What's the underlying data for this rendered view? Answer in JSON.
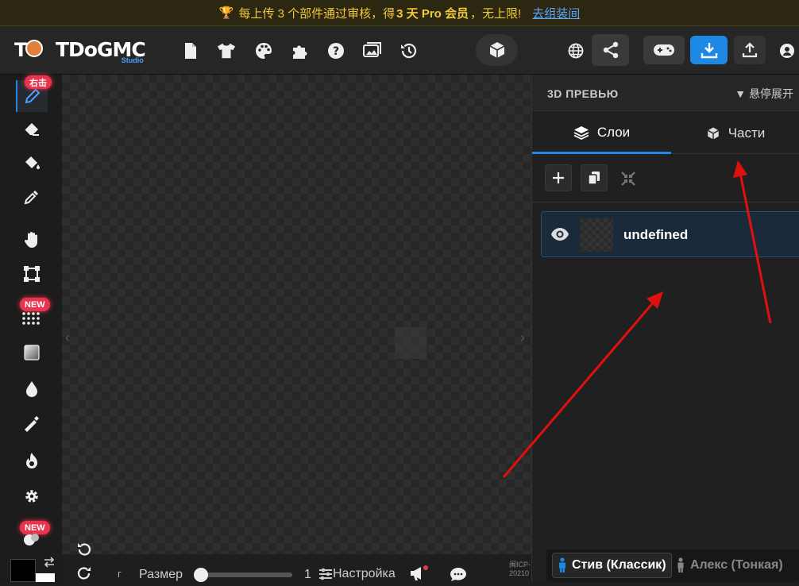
{
  "banner": {
    "prefix": "每上传 3 个部件通过审核，得",
    "highlight": "3 天 Pro 会员",
    "suffix": "，无上限!",
    "link": "去组装间"
  },
  "app": {
    "logo_t": "T",
    "name": "TDoGMC",
    "studio": "Studio"
  },
  "toolbar": {
    "icons": [
      "file-icon",
      "shirt-icon",
      "palette-icon",
      "puzzle-icon",
      "help-icon",
      "gallery-icon",
      "history-icon"
    ],
    "view_3d": "cube-icon",
    "right_icons": [
      "globe-icon",
      "share-icon",
      "gamepad-icon",
      "download-icon",
      "upload-icon",
      "account-icon"
    ],
    "accent": "#1e88e5"
  },
  "sidebar": {
    "badges": {
      "pencil": "右击",
      "grid": "NEW",
      "filter": "NEW"
    },
    "tools": [
      "pencil-icon",
      "eraser-icon",
      "bucket-icon",
      "eyedropper-icon",
      "hand-icon",
      "transform-icon",
      "dots-grid-icon",
      "gradient-icon",
      "blur-drop-icon",
      "brush-icon",
      "burn-icon",
      "settings-gear-icon",
      "filter-icon"
    ]
  },
  "bottom": {
    "size_prefix": "г",
    "size_label": "Размер",
    "size_value": "1",
    "size_fraction": 0,
    "settings_label": "Настройка",
    "icp_line1": "闽ICP-",
    "icp_line2": "20210"
  },
  "panel": {
    "title": "3D ПРЕВЬЮ",
    "hover_label": "▼ 悬停展开",
    "tabs": [
      {
        "label": "Слои",
        "icon": "layers-icon"
      },
      {
        "label": "Части",
        "icon": "cube-icon"
      }
    ],
    "layers": [
      {
        "name": "undefined"
      }
    ],
    "skins": [
      {
        "label": "Стив (Классик)",
        "selected": true
      },
      {
        "label": "Алекс (Тонкая)",
        "selected": false
      }
    ]
  },
  "colors": {
    "banner_text": "#f0c93a",
    "link": "#5aa9ff",
    "badge": "#e8344f",
    "arrow": "#e01010"
  }
}
